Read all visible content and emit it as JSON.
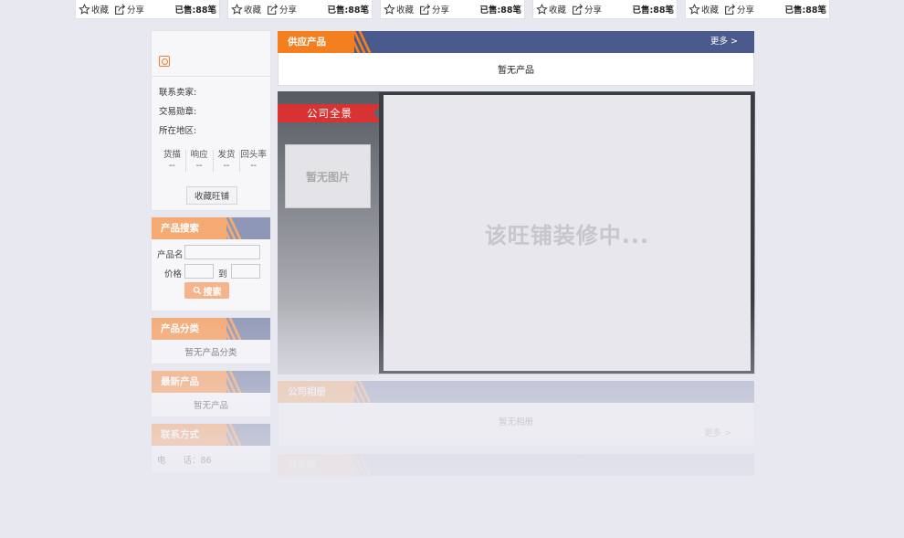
{
  "top_strip": {
    "cards": [
      {
        "fav_label": "收藏",
        "share_label": "分享",
        "sold": "已售:88笔"
      },
      {
        "fav_label": "收藏",
        "share_label": "分享",
        "sold": "已售:88笔"
      },
      {
        "fav_label": "收藏",
        "share_label": "分享",
        "sold": "已售:88笔"
      },
      {
        "fav_label": "收藏",
        "share_label": "分享",
        "sold": "已售:88笔"
      },
      {
        "fav_label": "收藏",
        "share_label": "分享",
        "sold": "已售:88笔"
      }
    ]
  },
  "shop": {
    "contact_label": "联系卖家:",
    "medal_label": "交易勋章:",
    "region_label": "所在地区:",
    "stats": [
      {
        "label": "货描",
        "value": "--"
      },
      {
        "label": "响应",
        "value": "--"
      },
      {
        "label": "发货",
        "value": "--"
      },
      {
        "label": "回头率",
        "value": "--"
      }
    ],
    "fav_button": "收藏旺铺"
  },
  "product_search": {
    "title": "产品搜索",
    "name_label": "产品名",
    "price_label": "价格",
    "to_label": "到",
    "button": "搜索"
  },
  "categories": {
    "title": "产品分类",
    "empty": "暂无产品分类"
  },
  "latest": {
    "title": "最新产品",
    "empty": "暂无产品"
  },
  "contact": {
    "title": "联系方式",
    "line": "电　　话：86"
  },
  "supply": {
    "title": "供应产品",
    "more": "更多 >",
    "empty": "暂无产品"
  },
  "panorama": {
    "ribbon": "公司全景",
    "thumb": "暂无图片",
    "placeholder": "该旺铺装修中..."
  },
  "album": {
    "title": "公司相册",
    "empty": "暂无相册",
    "more": "更多 >"
  },
  "bottom_section": {
    "title": "留言板"
  },
  "colors": {
    "accent": "#f47f1e",
    "nav": "#4a5a8c",
    "ribbon": "#d83232"
  }
}
